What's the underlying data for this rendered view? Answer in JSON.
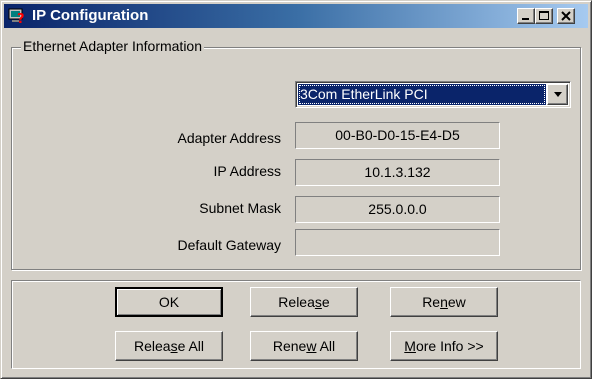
{
  "window": {
    "title": "IP Configuration",
    "controls": {
      "minimize": "minimize-icon",
      "maximize": "maximize-icon",
      "close": "close-icon"
    },
    "colors": {
      "titlebar_start": "#0a246a",
      "titlebar_end": "#a6caf0",
      "face": "#d4d0c8",
      "selection": "#0a246a"
    }
  },
  "adapter_group": {
    "legend": "Ethernet  Adapter Information",
    "adapter_select": {
      "selected": "3Com EtherLink PCI"
    },
    "fields": [
      {
        "label": "Adapter Address",
        "value": "00-B0-D0-15-E4-D5"
      },
      {
        "label": "IP Address",
        "value": "10.1.3.132"
      },
      {
        "label": "Subnet Mask",
        "value": "255.0.0.0"
      },
      {
        "label": "Default Gateway",
        "value": ""
      }
    ]
  },
  "buttons": {
    "ok": {
      "pre": "OK",
      "accel": "",
      "post": ""
    },
    "release": {
      "pre": "Relea",
      "accel": "s",
      "post": "e"
    },
    "renew": {
      "pre": "Re",
      "accel": "n",
      "post": "ew"
    },
    "release_all": {
      "pre": "Relea",
      "accel": "s",
      "post": "e All"
    },
    "renew_all": {
      "pre": "Rene",
      "accel": "w",
      "post": " All"
    },
    "more_info": {
      "pre": "",
      "accel": "M",
      "post": "ore Info >>"
    }
  }
}
